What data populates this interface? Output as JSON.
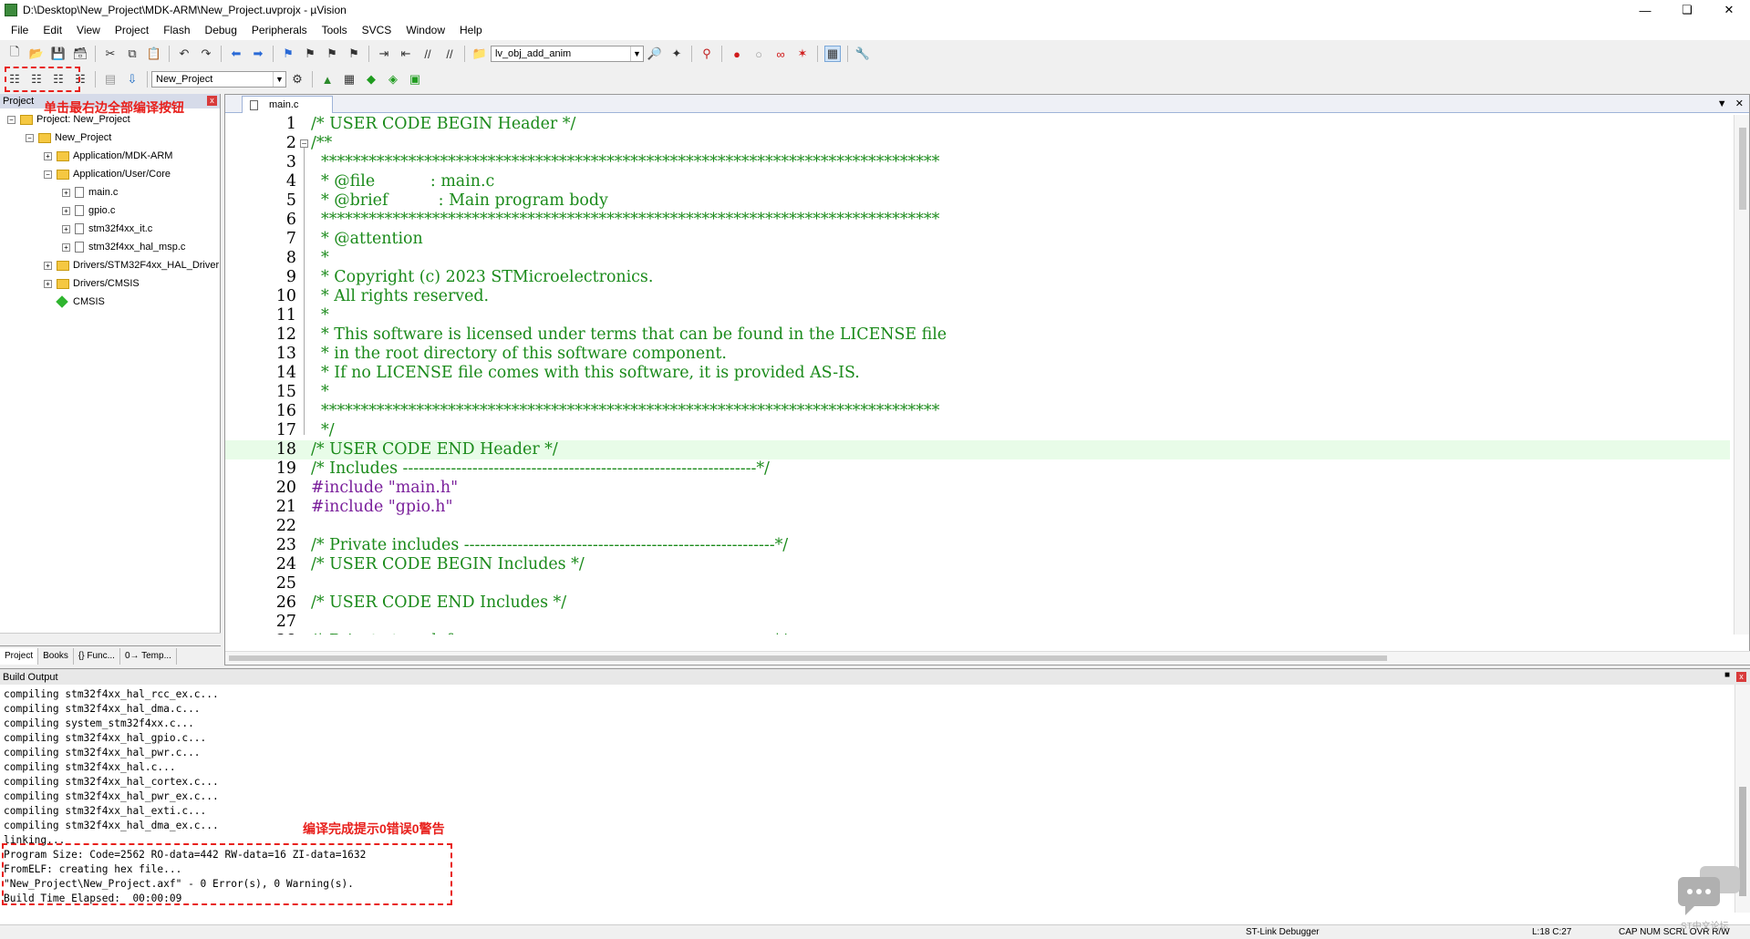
{
  "window": {
    "title": "D:\\Desktop\\New_Project\\MDK-ARM\\New_Project.uvprojx - µVision"
  },
  "menu": [
    "File",
    "Edit",
    "View",
    "Project",
    "Flash",
    "Debug",
    "Peripherals",
    "Tools",
    "SVCS",
    "Window",
    "Help"
  ],
  "toolbar": {
    "function_combo": "lv_obj_add_anim",
    "target_combo": "New_Project"
  },
  "project_pane": {
    "header": "Project",
    "tree": [
      {
        "label": "Project: New_Project",
        "indent": 0,
        "kind": "root"
      },
      {
        "label": "New_Project",
        "indent": 1,
        "kind": "target"
      },
      {
        "label": "Application/MDK-ARM",
        "indent": 2,
        "kind": "folder"
      },
      {
        "label": "Application/User/Core",
        "indent": 2,
        "kind": "folder"
      },
      {
        "label": "main.c",
        "indent": 3,
        "kind": "file"
      },
      {
        "label": "gpio.c",
        "indent": 3,
        "kind": "file"
      },
      {
        "label": "stm32f4xx_it.c",
        "indent": 3,
        "kind": "file"
      },
      {
        "label": "stm32f4xx_hal_msp.c",
        "indent": 3,
        "kind": "file"
      },
      {
        "label": "Drivers/STM32F4xx_HAL_Driver",
        "indent": 2,
        "kind": "folder"
      },
      {
        "label": "Drivers/CMSIS",
        "indent": 2,
        "kind": "folder"
      },
      {
        "label": "CMSIS",
        "indent": 2,
        "kind": "gem"
      }
    ],
    "tabs": [
      "Project",
      "Books",
      "{} Func...",
      "0→ Temp..."
    ]
  },
  "annotations": {
    "build_all": "单击最右边全部编译按钮",
    "result": "编译完成提示0错误0警告"
  },
  "editor": {
    "tab": "main.c",
    "lines": [
      "/* USER CODE BEGIN Header */",
      "/**",
      "  ******************************************************************************",
      "  * @file           : main.c",
      "  * @brief          : Main program body",
      "  ******************************************************************************",
      "  * @attention",
      "  *",
      "  * Copyright (c) 2023 STMicroelectronics.",
      "  * All rights reserved.",
      "  *",
      "  * This software is licensed under terms that can be found in the LICENSE file",
      "  * in the root directory of this software component.",
      "  * If no LICENSE file comes with this software, it is provided AS-IS.",
      "  *",
      "  ******************************************************************************",
      "  */",
      "/* USER CODE END Header */",
      "/* Includes ------------------------------------------------------------------*/",
      "#include \"main.h\"",
      "#include \"gpio.h\"",
      "",
      "/* Private includes ----------------------------------------------------------*/",
      "/* USER CODE BEGIN Includes */",
      "",
      "/* USER CODE END Includes */",
      "",
      "/* Private typedef -----------------------------------------------------------*/"
    ]
  },
  "build_output": {
    "header": "Build Output",
    "lines": [
      "compiling stm32f4xx_hal_rcc_ex.c...",
      "compiling stm32f4xx_hal_dma.c...",
      "compiling system_stm32f4xx.c...",
      "compiling stm32f4xx_hal_gpio.c...",
      "compiling stm32f4xx_hal_pwr.c...",
      "compiling stm32f4xx_hal.c...",
      "compiling stm32f4xx_hal_cortex.c...",
      "compiling stm32f4xx_hal_pwr_ex.c...",
      "compiling stm32f4xx_hal_exti.c...",
      "compiling stm32f4xx_hal_dma_ex.c...",
      "linking...",
      "Program Size: Code=2562 RO-data=442 RW-data=16 ZI-data=1632",
      "FromELF: creating hex file...",
      "\"New_Project\\New_Project.axf\" - 0 Error(s), 0 Warning(s).",
      "Build Time Elapsed:  00:00:09"
    ]
  },
  "status": {
    "debugger": "ST-Link Debugger",
    "position": "L:18 C:27",
    "flags": "CAP  NUM  SCRL  OVR  R/W"
  },
  "watermark": "ST中文论坛"
}
